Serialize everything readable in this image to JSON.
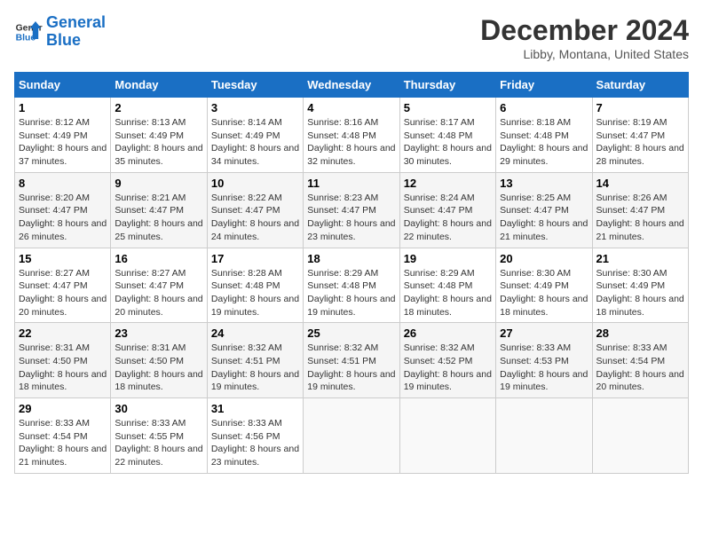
{
  "logo": {
    "line1": "General",
    "line2": "Blue"
  },
  "calendar": {
    "title": "December 2024",
    "subtitle": "Libby, Montana, United States",
    "days_of_week": [
      "Sunday",
      "Monday",
      "Tuesday",
      "Wednesday",
      "Thursday",
      "Friday",
      "Saturday"
    ],
    "weeks": [
      [
        {
          "day": "1",
          "sunrise": "Sunrise: 8:12 AM",
          "sunset": "Sunset: 4:49 PM",
          "daylight": "Daylight: 8 hours and 37 minutes."
        },
        {
          "day": "2",
          "sunrise": "Sunrise: 8:13 AM",
          "sunset": "Sunset: 4:49 PM",
          "daylight": "Daylight: 8 hours and 35 minutes."
        },
        {
          "day": "3",
          "sunrise": "Sunrise: 8:14 AM",
          "sunset": "Sunset: 4:49 PM",
          "daylight": "Daylight: 8 hours and 34 minutes."
        },
        {
          "day": "4",
          "sunrise": "Sunrise: 8:16 AM",
          "sunset": "Sunset: 4:48 PM",
          "daylight": "Daylight: 8 hours and 32 minutes."
        },
        {
          "day": "5",
          "sunrise": "Sunrise: 8:17 AM",
          "sunset": "Sunset: 4:48 PM",
          "daylight": "Daylight: 8 hours and 30 minutes."
        },
        {
          "day": "6",
          "sunrise": "Sunrise: 8:18 AM",
          "sunset": "Sunset: 4:48 PM",
          "daylight": "Daylight: 8 hours and 29 minutes."
        },
        {
          "day": "7",
          "sunrise": "Sunrise: 8:19 AM",
          "sunset": "Sunset: 4:47 PM",
          "daylight": "Daylight: 8 hours and 28 minutes."
        }
      ],
      [
        {
          "day": "8",
          "sunrise": "Sunrise: 8:20 AM",
          "sunset": "Sunset: 4:47 PM",
          "daylight": "Daylight: 8 hours and 26 minutes."
        },
        {
          "day": "9",
          "sunrise": "Sunrise: 8:21 AM",
          "sunset": "Sunset: 4:47 PM",
          "daylight": "Daylight: 8 hours and 25 minutes."
        },
        {
          "day": "10",
          "sunrise": "Sunrise: 8:22 AM",
          "sunset": "Sunset: 4:47 PM",
          "daylight": "Daylight: 8 hours and 24 minutes."
        },
        {
          "day": "11",
          "sunrise": "Sunrise: 8:23 AM",
          "sunset": "Sunset: 4:47 PM",
          "daylight": "Daylight: 8 hours and 23 minutes."
        },
        {
          "day": "12",
          "sunrise": "Sunrise: 8:24 AM",
          "sunset": "Sunset: 4:47 PM",
          "daylight": "Daylight: 8 hours and 22 minutes."
        },
        {
          "day": "13",
          "sunrise": "Sunrise: 8:25 AM",
          "sunset": "Sunset: 4:47 PM",
          "daylight": "Daylight: 8 hours and 21 minutes."
        },
        {
          "day": "14",
          "sunrise": "Sunrise: 8:26 AM",
          "sunset": "Sunset: 4:47 PM",
          "daylight": "Daylight: 8 hours and 21 minutes."
        }
      ],
      [
        {
          "day": "15",
          "sunrise": "Sunrise: 8:27 AM",
          "sunset": "Sunset: 4:47 PM",
          "daylight": "Daylight: 8 hours and 20 minutes."
        },
        {
          "day": "16",
          "sunrise": "Sunrise: 8:27 AM",
          "sunset": "Sunset: 4:47 PM",
          "daylight": "Daylight: 8 hours and 20 minutes."
        },
        {
          "day": "17",
          "sunrise": "Sunrise: 8:28 AM",
          "sunset": "Sunset: 4:48 PM",
          "daylight": "Daylight: 8 hours and 19 minutes."
        },
        {
          "day": "18",
          "sunrise": "Sunrise: 8:29 AM",
          "sunset": "Sunset: 4:48 PM",
          "daylight": "Daylight: 8 hours and 19 minutes."
        },
        {
          "day": "19",
          "sunrise": "Sunrise: 8:29 AM",
          "sunset": "Sunset: 4:48 PM",
          "daylight": "Daylight: 8 hours and 18 minutes."
        },
        {
          "day": "20",
          "sunrise": "Sunrise: 8:30 AM",
          "sunset": "Sunset: 4:49 PM",
          "daylight": "Daylight: 8 hours and 18 minutes."
        },
        {
          "day": "21",
          "sunrise": "Sunrise: 8:30 AM",
          "sunset": "Sunset: 4:49 PM",
          "daylight": "Daylight: 8 hours and 18 minutes."
        }
      ],
      [
        {
          "day": "22",
          "sunrise": "Sunrise: 8:31 AM",
          "sunset": "Sunset: 4:50 PM",
          "daylight": "Daylight: 8 hours and 18 minutes."
        },
        {
          "day": "23",
          "sunrise": "Sunrise: 8:31 AM",
          "sunset": "Sunset: 4:50 PM",
          "daylight": "Daylight: 8 hours and 18 minutes."
        },
        {
          "day": "24",
          "sunrise": "Sunrise: 8:32 AM",
          "sunset": "Sunset: 4:51 PM",
          "daylight": "Daylight: 8 hours and 19 minutes."
        },
        {
          "day": "25",
          "sunrise": "Sunrise: 8:32 AM",
          "sunset": "Sunset: 4:51 PM",
          "daylight": "Daylight: 8 hours and 19 minutes."
        },
        {
          "day": "26",
          "sunrise": "Sunrise: 8:32 AM",
          "sunset": "Sunset: 4:52 PM",
          "daylight": "Daylight: 8 hours and 19 minutes."
        },
        {
          "day": "27",
          "sunrise": "Sunrise: 8:33 AM",
          "sunset": "Sunset: 4:53 PM",
          "daylight": "Daylight: 8 hours and 19 minutes."
        },
        {
          "day": "28",
          "sunrise": "Sunrise: 8:33 AM",
          "sunset": "Sunset: 4:54 PM",
          "daylight": "Daylight: 8 hours and 20 minutes."
        }
      ],
      [
        {
          "day": "29",
          "sunrise": "Sunrise: 8:33 AM",
          "sunset": "Sunset: 4:54 PM",
          "daylight": "Daylight: 8 hours and 21 minutes."
        },
        {
          "day": "30",
          "sunrise": "Sunrise: 8:33 AM",
          "sunset": "Sunset: 4:55 PM",
          "daylight": "Daylight: 8 hours and 22 minutes."
        },
        {
          "day": "31",
          "sunrise": "Sunrise: 8:33 AM",
          "sunset": "Sunset: 4:56 PM",
          "daylight": "Daylight: 8 hours and 23 minutes."
        },
        null,
        null,
        null,
        null
      ]
    ]
  }
}
